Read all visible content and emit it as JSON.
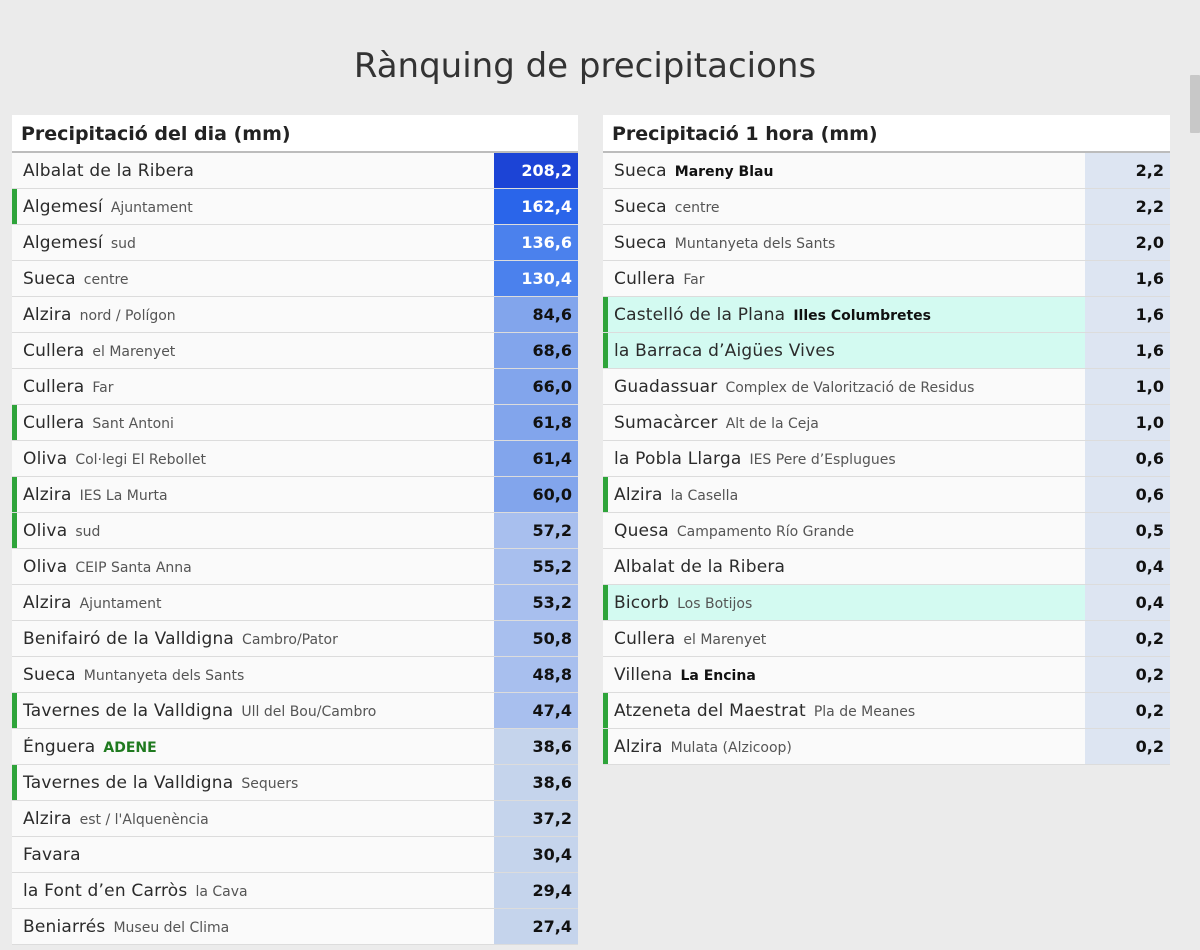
{
  "page": {
    "title": "Rànquing de precipitacions"
  },
  "day_ranking": {
    "title": "Precipitació del dia (mm)",
    "rows": [
      {
        "city": "Albalat de la Ribera",
        "station": "",
        "value": "208,2",
        "bg": "#1c44d6",
        "fg": "#ffffff",
        "flag": false,
        "highlight": false,
        "bold_station": false
      },
      {
        "city": "Algemesí",
        "station": "Ajuntament",
        "value": "162,4",
        "bg": "#2a65ea",
        "fg": "#ffffff",
        "flag": true,
        "highlight": false,
        "bold_station": false
      },
      {
        "city": "Algemesí",
        "station": "sud",
        "value": "136,6",
        "bg": "#4b81ed",
        "fg": "#ffffff",
        "flag": false,
        "highlight": false,
        "bold_station": false
      },
      {
        "city": "Sueca",
        "station": "centre",
        "value": "130,4",
        "bg": "#4b81ed",
        "fg": "#ffffff",
        "flag": false,
        "highlight": false,
        "bold_station": false
      },
      {
        "city": "Alzira",
        "station": "nord / Polígon",
        "value": "84,6",
        "bg": "#82a5ec",
        "fg": "#111111",
        "flag": false,
        "highlight": false,
        "bold_station": false
      },
      {
        "city": "Cullera",
        "station": "el Marenyet",
        "value": "68,6",
        "bg": "#82a5ec",
        "fg": "#111111",
        "flag": false,
        "highlight": false,
        "bold_station": false
      },
      {
        "city": "Cullera",
        "station": "Far",
        "value": "66,0",
        "bg": "#82a5ec",
        "fg": "#111111",
        "flag": false,
        "highlight": false,
        "bold_station": false
      },
      {
        "city": "Cullera",
        "station": "Sant Antoni",
        "value": "61,8",
        "bg": "#82a5ec",
        "fg": "#111111",
        "flag": true,
        "highlight": false,
        "bold_station": false
      },
      {
        "city": "Oliva",
        "station": "Col·legi El Rebollet",
        "value": "61,4",
        "bg": "#82a5ec",
        "fg": "#111111",
        "flag": false,
        "highlight": false,
        "bold_station": false
      },
      {
        "city": "Alzira",
        "station": "IES La Murta",
        "value": "60,0",
        "bg": "#82a5ec",
        "fg": "#111111",
        "flag": true,
        "highlight": false,
        "bold_station": false
      },
      {
        "city": "Oliva",
        "station": "sud",
        "value": "57,2",
        "bg": "#a8bfee",
        "fg": "#111111",
        "flag": true,
        "highlight": false,
        "bold_station": false
      },
      {
        "city": "Oliva",
        "station": "CEIP Santa Anna",
        "value": "55,2",
        "bg": "#a8bfee",
        "fg": "#111111",
        "flag": false,
        "highlight": false,
        "bold_station": false
      },
      {
        "city": "Alzira",
        "station": "Ajuntament",
        "value": "53,2",
        "bg": "#a8bfee",
        "fg": "#111111",
        "flag": false,
        "highlight": false,
        "bold_station": false
      },
      {
        "city": "Benifairó de la Valldigna",
        "station": "Cambro/Pator",
        "value": "50,8",
        "bg": "#a8bfee",
        "fg": "#111111",
        "flag": false,
        "highlight": false,
        "bold_station": false
      },
      {
        "city": "Sueca",
        "station": "Muntanyeta dels Sants",
        "value": "48,8",
        "bg": "#a8bfee",
        "fg": "#111111",
        "flag": false,
        "highlight": false,
        "bold_station": false
      },
      {
        "city": "Tavernes de la Valldigna",
        "station": "Ull del Bou/Cambro",
        "value": "47,4",
        "bg": "#a8bfee",
        "fg": "#111111",
        "flag": true,
        "highlight": false,
        "bold_station": false
      },
      {
        "city": "Énguera",
        "station": "ADENE",
        "value": "38,6",
        "bg": "#c5d4ec",
        "fg": "#111111",
        "flag": false,
        "highlight": false,
        "bold_station": false,
        "green_station": true
      },
      {
        "city": "Tavernes de la Valldigna",
        "station": "Sequers",
        "value": "38,6",
        "bg": "#c5d4ec",
        "fg": "#111111",
        "flag": true,
        "highlight": false,
        "bold_station": false
      },
      {
        "city": "Alzira",
        "station": "est / l'Alquenència",
        "value": "37,2",
        "bg": "#c5d4ec",
        "fg": "#111111",
        "flag": false,
        "highlight": false,
        "bold_station": false
      },
      {
        "city": "Favara",
        "station": "",
        "value": "30,4",
        "bg": "#c5d4ec",
        "fg": "#111111",
        "flag": false,
        "highlight": false,
        "bold_station": false
      },
      {
        "city": "la Font d’en Carròs",
        "station": "la Cava",
        "value": "29,4",
        "bg": "#c5d4ec",
        "fg": "#111111",
        "flag": false,
        "highlight": false,
        "bold_station": false
      },
      {
        "city": "Beniarrés",
        "station": "Museu del Clima",
        "value": "27,4",
        "bg": "#c5d4ec",
        "fg": "#111111",
        "flag": false,
        "highlight": false,
        "bold_station": false
      }
    ]
  },
  "hour_ranking": {
    "title": "Precipitació 1 hora (mm)",
    "rows": [
      {
        "city": "Sueca",
        "station": "Mareny Blau",
        "value": "2,2",
        "bg": "#dde5f2",
        "fg": "#111111",
        "flag": false,
        "highlight": false,
        "bold_station": true
      },
      {
        "city": "Sueca",
        "station": "centre",
        "value": "2,2",
        "bg": "#dde5f2",
        "fg": "#111111",
        "flag": false,
        "highlight": false,
        "bold_station": false
      },
      {
        "city": "Sueca",
        "station": "Muntanyeta dels Sants",
        "value": "2,0",
        "bg": "#dde5f2",
        "fg": "#111111",
        "flag": false,
        "highlight": false,
        "bold_station": false
      },
      {
        "city": "Cullera",
        "station": "Far",
        "value": "1,6",
        "bg": "#dde5f2",
        "fg": "#111111",
        "flag": false,
        "highlight": false,
        "bold_station": false
      },
      {
        "city": "Castelló de la Plana",
        "station": "Illes Columbretes",
        "value": "1,6",
        "bg": "#dde5f2",
        "fg": "#111111",
        "flag": true,
        "highlight": true,
        "bold_station": true
      },
      {
        "city": "la Barraca d’Aigües Vives",
        "station": "",
        "value": "1,6",
        "bg": "#dde5f2",
        "fg": "#111111",
        "flag": true,
        "highlight": true,
        "bold_station": false
      },
      {
        "city": "Guadassuar",
        "station": "Complex de Valorització de Residus",
        "value": "1,0",
        "bg": "#dde5f2",
        "fg": "#111111",
        "flag": false,
        "highlight": false,
        "bold_station": false
      },
      {
        "city": "Sumacàrcer",
        "station": "Alt de la Ceja",
        "value": "1,0",
        "bg": "#dde5f2",
        "fg": "#111111",
        "flag": false,
        "highlight": false,
        "bold_station": false
      },
      {
        "city": "la Pobla Llarga",
        "station": "IES Pere d’Esplugues",
        "value": "0,6",
        "bg": "#dde5f2",
        "fg": "#111111",
        "flag": false,
        "highlight": false,
        "bold_station": false
      },
      {
        "city": "Alzira",
        "station": "la Casella",
        "value": "0,6",
        "bg": "#dde5f2",
        "fg": "#111111",
        "flag": true,
        "highlight": false,
        "bold_station": false
      },
      {
        "city": "Quesa",
        "station": "Campamento Río Grande",
        "value": "0,5",
        "bg": "#dde5f2",
        "fg": "#111111",
        "flag": false,
        "highlight": false,
        "bold_station": false
      },
      {
        "city": "Albalat de la Ribera",
        "station": "",
        "value": "0,4",
        "bg": "#dde5f2",
        "fg": "#111111",
        "flag": false,
        "highlight": false,
        "bold_station": false
      },
      {
        "city": "Bicorb",
        "station": "Los Botijos",
        "value": "0,4",
        "bg": "#dde5f2",
        "fg": "#111111",
        "flag": true,
        "highlight": true,
        "bold_station": false
      },
      {
        "city": "Cullera",
        "station": "el Marenyet",
        "value": "0,2",
        "bg": "#dde5f2",
        "fg": "#111111",
        "flag": false,
        "highlight": false,
        "bold_station": false
      },
      {
        "city": "Villena",
        "station": "La Encina",
        "value": "0,2",
        "bg": "#dde5f2",
        "fg": "#111111",
        "flag": false,
        "highlight": false,
        "bold_station": true
      },
      {
        "city": "Atzeneta del Maestrat",
        "station": "Pla de Meanes",
        "value": "0,2",
        "bg": "#dde5f2",
        "fg": "#111111",
        "flag": true,
        "highlight": false,
        "bold_station": false
      },
      {
        "city": "Alzira",
        "station": "Mulata (Alzicoop)",
        "value": "0,2",
        "bg": "#dde5f2",
        "fg": "#111111",
        "flag": true,
        "highlight": false,
        "bold_station": false
      }
    ]
  }
}
